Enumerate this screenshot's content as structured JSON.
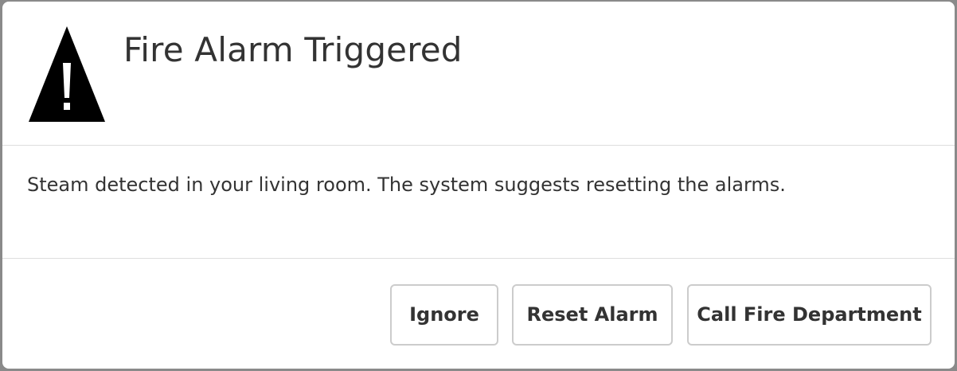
{
  "dialog": {
    "title": "Fire Alarm Triggered",
    "icon": "warning-triangle-icon",
    "message": "Steam detected in your living room. The system suggests resetting the alarms.",
    "buttons": {
      "ignore_label": "Ignore",
      "reset_label": "Reset Alarm",
      "call_label": "Call Fire Department"
    }
  },
  "colors": {
    "text": "#333333",
    "divider": "#dedede",
    "button_border": "#cccccc",
    "icon": "#000000",
    "background": "#ffffff"
  }
}
